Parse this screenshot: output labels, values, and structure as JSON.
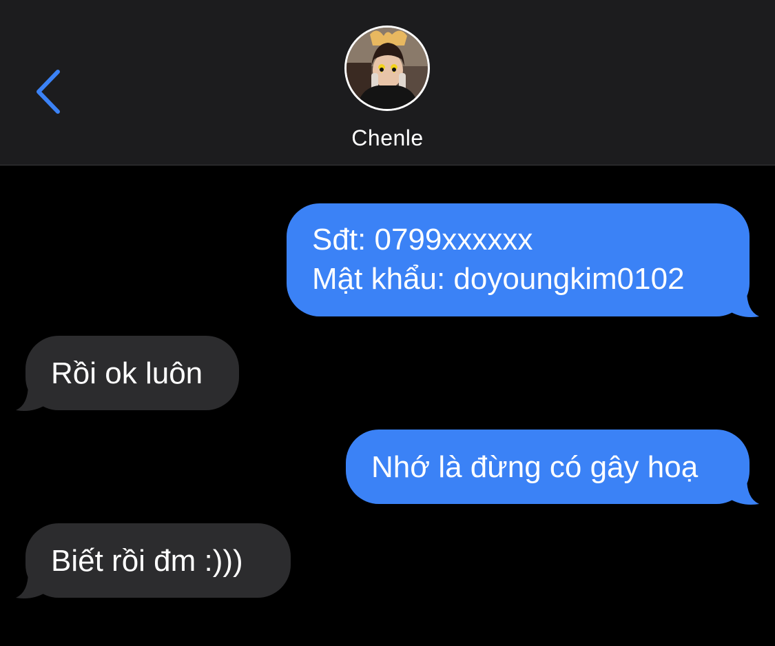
{
  "header": {
    "back_icon": "chevron-left-icon",
    "contact_name": "Chenle",
    "avatar_icon": "contact-avatar-photo",
    "accent_color": "#3b82f6"
  },
  "messages": [
    {
      "direction": "sent",
      "lines": [
        "Sđt: 0799xxxxxx",
        "Mật khẩu: doyoungkim0102"
      ]
    },
    {
      "direction": "received",
      "lines": [
        "Rồi ok luôn"
      ]
    },
    {
      "direction": "sent",
      "lines": [
        "Nhớ là đừng có gây hoạ"
      ]
    },
    {
      "direction": "received",
      "lines": [
        "Biết rồi đm :)))"
      ]
    }
  ],
  "colors": {
    "sent_bubble": "#3b82f6",
    "received_bubble": "#2c2c2e",
    "header_bg": "#1c1c1e",
    "background": "#000000"
  }
}
